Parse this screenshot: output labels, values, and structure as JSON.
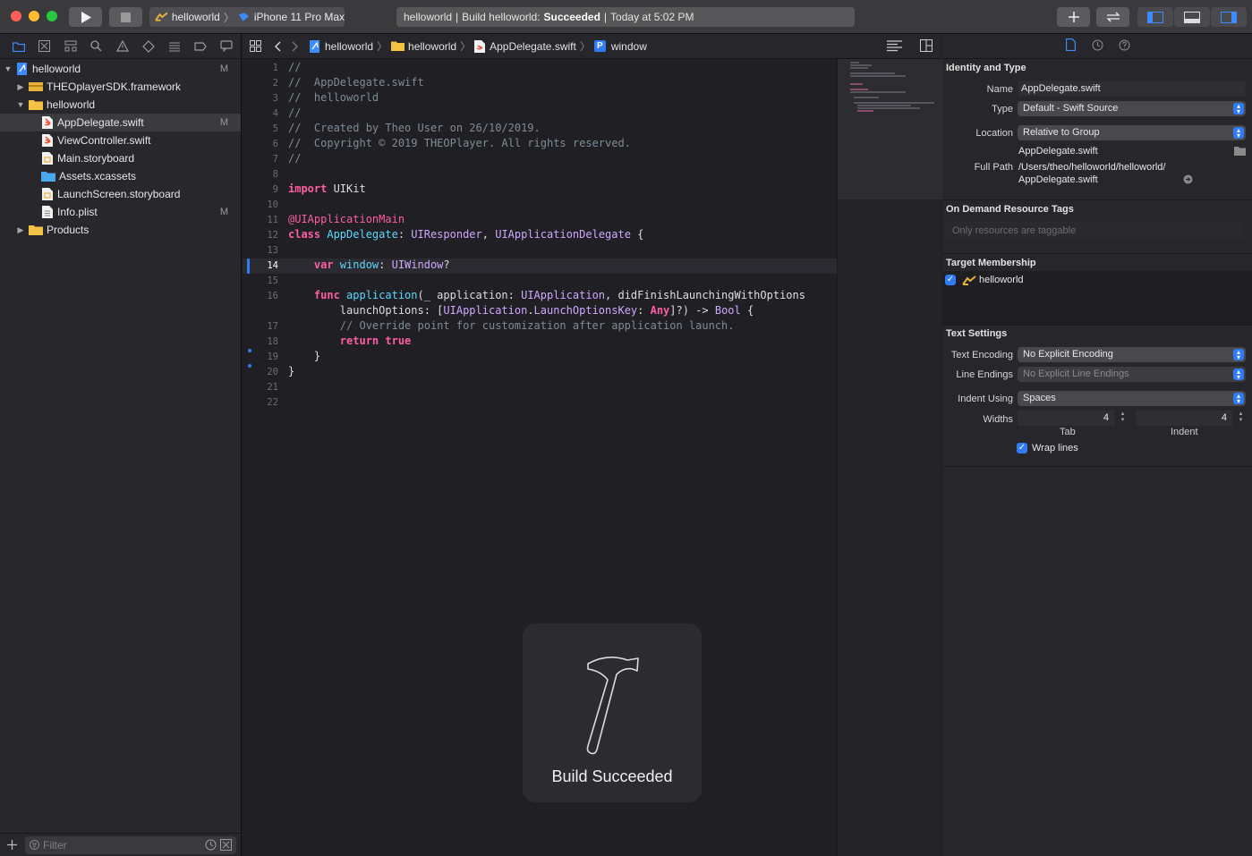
{
  "toolbar": {
    "scheme_project": "helloworld",
    "scheme_device": "iPhone 11 Pro Max",
    "activity_project": "helloworld",
    "activity_prefix": "Build helloworld:",
    "activity_status": "Succeeded",
    "activity_time": "Today at 5:02 PM",
    "sep": "|"
  },
  "navigator": {
    "items": [
      {
        "label": "helloworld",
        "badge": "M",
        "icon": "project-icon"
      },
      {
        "label": "THEOplayerSDK.framework",
        "badge": "",
        "icon": "framework-icon"
      },
      {
        "label": "helloworld",
        "badge": "",
        "icon": "folder-icon"
      },
      {
        "label": "AppDelegate.swift",
        "badge": "M",
        "icon": "swift-file-icon"
      },
      {
        "label": "ViewController.swift",
        "badge": "",
        "icon": "swift-file-icon"
      },
      {
        "label": "Main.storyboard",
        "badge": "",
        "icon": "storyboard-icon"
      },
      {
        "label": "Assets.xcassets",
        "badge": "",
        "icon": "assets-folder-icon"
      },
      {
        "label": "LaunchScreen.storyboard",
        "badge": "",
        "icon": "storyboard-icon"
      },
      {
        "label": "Info.plist",
        "badge": "M",
        "icon": "plist-icon"
      },
      {
        "label": "Products",
        "badge": "",
        "icon": "folder-icon"
      }
    ],
    "filter_placeholder": "Filter"
  },
  "jumpbar": {
    "project": "helloworld",
    "group": "helloworld",
    "file": "AppDelegate.swift",
    "symbol_badge": "P",
    "symbol": "window"
  },
  "code": {
    "line_numbers": [
      "1",
      "2",
      "3",
      "4",
      "5",
      "6",
      "7",
      "8",
      "9",
      "10",
      "11",
      "12",
      "13",
      "14",
      "15",
      "16",
      "",
      "17",
      "18",
      "19",
      "20",
      "21",
      "22"
    ],
    "current_line": "14",
    "lines": {
      "l1": "//",
      "l2": "//  AppDelegate.swift",
      "l3": "//  helloworld",
      "l4": "//",
      "l5": "//  Created by Theo User on 26/10/2019.",
      "l6": "//  Copyright © 2019 THEOPlayer. All rights reserved.",
      "l7": "//",
      "l9_kw": "import",
      "l9_name": " UIKit",
      "l11": "@UIApplicationMain",
      "l12_kw": "class",
      "l12_name": " AppDelegate",
      "l12_colon": ": ",
      "l12_t1": "UIResponder",
      "l12_comma": ", ",
      "l12_t2": "UIApplicationDelegate",
      "l12_end": " {",
      "l14_kw": "    var",
      "l14_name": " window",
      "l14_colon": ": ",
      "l14_type": "UIWindow",
      "l14_end": "?",
      "l16_kw": "    func",
      "l16_name": " application",
      "l16_a": "(_ application: ",
      "l16_type": "UIApplication",
      "l16_b": ", didFinishLaunchingWithOptions",
      "l16c_a": "        launchOptions: [",
      "l16c_t1": "UIApplication",
      "l16c_dot": ".",
      "l16c_t2": "LaunchOptionsKey",
      "l16c_colon": ": ",
      "l16c_t3": "Any",
      "l16c_b": "]?) -> ",
      "l16c_t4": "Bool",
      "l16c_end": " {",
      "l17": "        // Override point for customization after application launch.",
      "l18_kw": "        return",
      "l18_val": " true",
      "l19": "    }",
      "l20": "}"
    }
  },
  "hud": {
    "text": "Build Succeeded"
  },
  "inspector": {
    "identity_title": "Identity and Type",
    "name_label": "Name",
    "name_value": "AppDelegate.swift",
    "type_label": "Type",
    "type_value": "Default - Swift Source",
    "location_label": "Location",
    "location_value": "Relative to Group",
    "location_file": "AppDelegate.swift",
    "fullpath_label": "Full Path",
    "fullpath_line1": "/Users/theo/helloworld/helloworld/",
    "fullpath_line2": "AppDelegate.swift",
    "odr_title": "On Demand Resource Tags",
    "odr_placeholder": "Only resources are taggable",
    "target_title": "Target Membership",
    "target_name": "helloworld",
    "text_title": "Text Settings",
    "encoding_label": "Text Encoding",
    "encoding_value": "No Explicit Encoding",
    "line_endings_label": "Line Endings",
    "line_endings_value": "No Explicit Line Endings",
    "indent_label": "Indent Using",
    "indent_value": "Spaces",
    "widths_label": "Widths",
    "tab_width": "4",
    "indent_width": "4",
    "tab_label": "Tab",
    "indent_col_label": "Indent",
    "wrap_label": "Wrap lines"
  },
  "colors": {
    "accent": "#2f7cf6",
    "keyword": "#fc5fa3",
    "type": "#d0a8ff",
    "declaration": "#5dd8ff",
    "comment": "#7f8c98"
  }
}
